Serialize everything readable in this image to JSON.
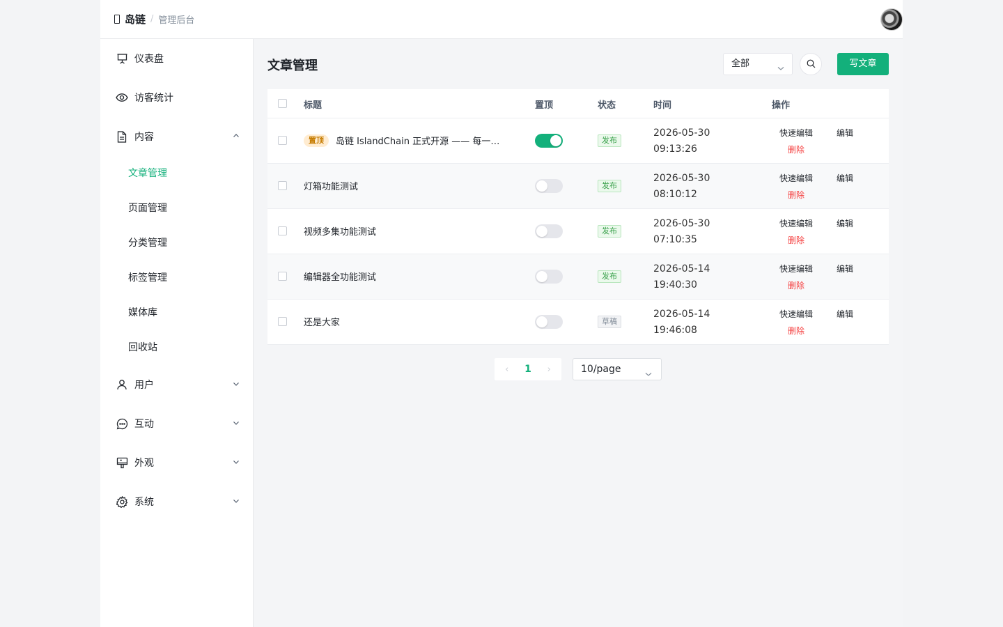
{
  "brand": {
    "name": "岛链",
    "separator": "/",
    "subtitle": "管理后台"
  },
  "sidebar": {
    "items": [
      {
        "label": "仪表盘",
        "icon": "presentation-board-icon"
      },
      {
        "label": "访客统计",
        "icon": "eye-icon"
      },
      {
        "label": "内容",
        "icon": "document-icon",
        "expanded": true
      },
      {
        "label": "用户",
        "icon": "user-icon",
        "expanded": false
      },
      {
        "label": "互动",
        "icon": "chat-bubble-icon",
        "expanded": false
      },
      {
        "label": "外观",
        "icon": "paint-brush-icon",
        "expanded": false
      },
      {
        "label": "系统",
        "icon": "gear-icon",
        "expanded": false
      }
    ],
    "content_sub": [
      "文章管理",
      "页面管理",
      "分类管理",
      "标签管理",
      "媒体库",
      "回收站"
    ],
    "active_sub": "文章管理"
  },
  "main": {
    "title": "文章管理",
    "filter": {
      "value": "全部"
    },
    "write_button": "写文章",
    "accent_color": "#13b07b"
  },
  "table": {
    "headers": {
      "title": "标题",
      "pinned": "置顶",
      "status": "状态",
      "time": "时间",
      "actions": "操作"
    },
    "actions": {
      "quick_edit": "快速编辑",
      "edit": "编辑",
      "delete": "删除"
    },
    "pin_tag": "置顶",
    "rows": [
      {
        "title": "岛链 IslandChain 正式开源 —— 每一…",
        "pinned": true,
        "status": "发布",
        "date": "2026-05-30",
        "clock": "09:13:26"
      },
      {
        "title": "灯箱功能测试",
        "pinned": false,
        "status": "发布",
        "date": "2026-05-30",
        "clock": "08:10:12"
      },
      {
        "title": "视频多集功能测试",
        "pinned": false,
        "status": "发布",
        "date": "2026-05-30",
        "clock": "07:10:35"
      },
      {
        "title": "编辑器全功能测试",
        "pinned": false,
        "status": "发布",
        "date": "2026-05-14",
        "clock": "19:40:30"
      },
      {
        "title": "还是大家",
        "pinned": false,
        "status": "草稿",
        "date": "2026-05-14",
        "clock": "19:46:08"
      }
    ]
  },
  "pagination": {
    "prev": "‹",
    "current": "1",
    "next": "›",
    "page_size": "10/page"
  }
}
